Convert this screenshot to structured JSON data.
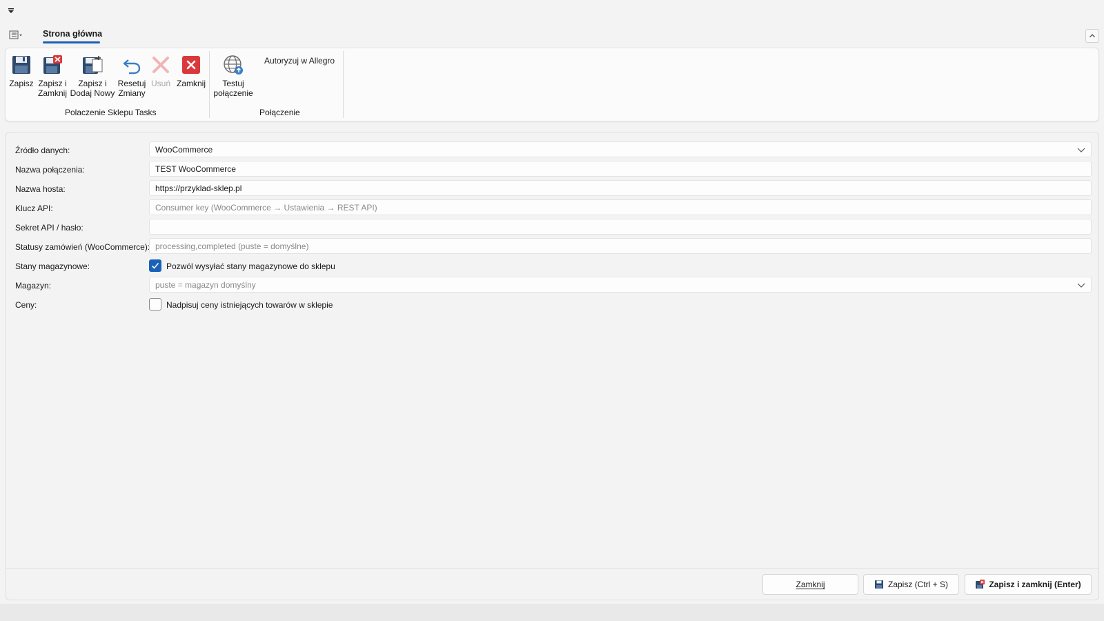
{
  "ribbon": {
    "tab_active": "Strona główna",
    "buttons": {
      "save": "Zapisz",
      "save_close": "Zapisz i\nZamknij",
      "save_new": "Zapisz i\nDodaj Nowy",
      "reset": "Resetuj\nZmiany",
      "delete": "Usuń",
      "close": "Zamknij",
      "test": "Testuj\npołączenie",
      "authorize": "Autoryzuj w Allegro"
    },
    "groups": {
      "tasks": "Polaczenie Sklepu Tasks",
      "connection": "Połączenie"
    }
  },
  "form": {
    "source": {
      "label": "Źródło danych:",
      "value": "WooCommerce"
    },
    "name": {
      "label": "Nazwa połączenia:",
      "value": "TEST WooCommerce"
    },
    "host": {
      "label": "Nazwa hosta:",
      "value": "https://przyklad-sklep.pl"
    },
    "api_key": {
      "label": "Klucz API:",
      "placeholder": "Consumer key (WooCommerce → Ustawienia → REST API)"
    },
    "api_secret": {
      "label": "Sekret API / hasło:",
      "value": ""
    },
    "statuses": {
      "label": "Statusy zamówień (WooCommerce):",
      "placeholder": "processing,completed (puste = domyślne)"
    },
    "stock": {
      "label": "Stany magazynowe:",
      "checkbox_label": "Pozwól wysyłać stany magazynowe do sklepu",
      "checked": true
    },
    "warehouse": {
      "label": "Magazyn:",
      "placeholder": "puste = magazyn domyślny"
    },
    "prices": {
      "label": "Ceny:",
      "checkbox_label": "Nadpisuj ceny istniejących towarów w sklepie",
      "checked": false
    }
  },
  "footer": {
    "close": "Zamknij",
    "save": "Zapisz (Ctrl + S)",
    "save_close": "Zapisz i zamknij (Enter)"
  },
  "colors": {
    "accent": "#1a62b8",
    "close_red": "#d9393a"
  }
}
